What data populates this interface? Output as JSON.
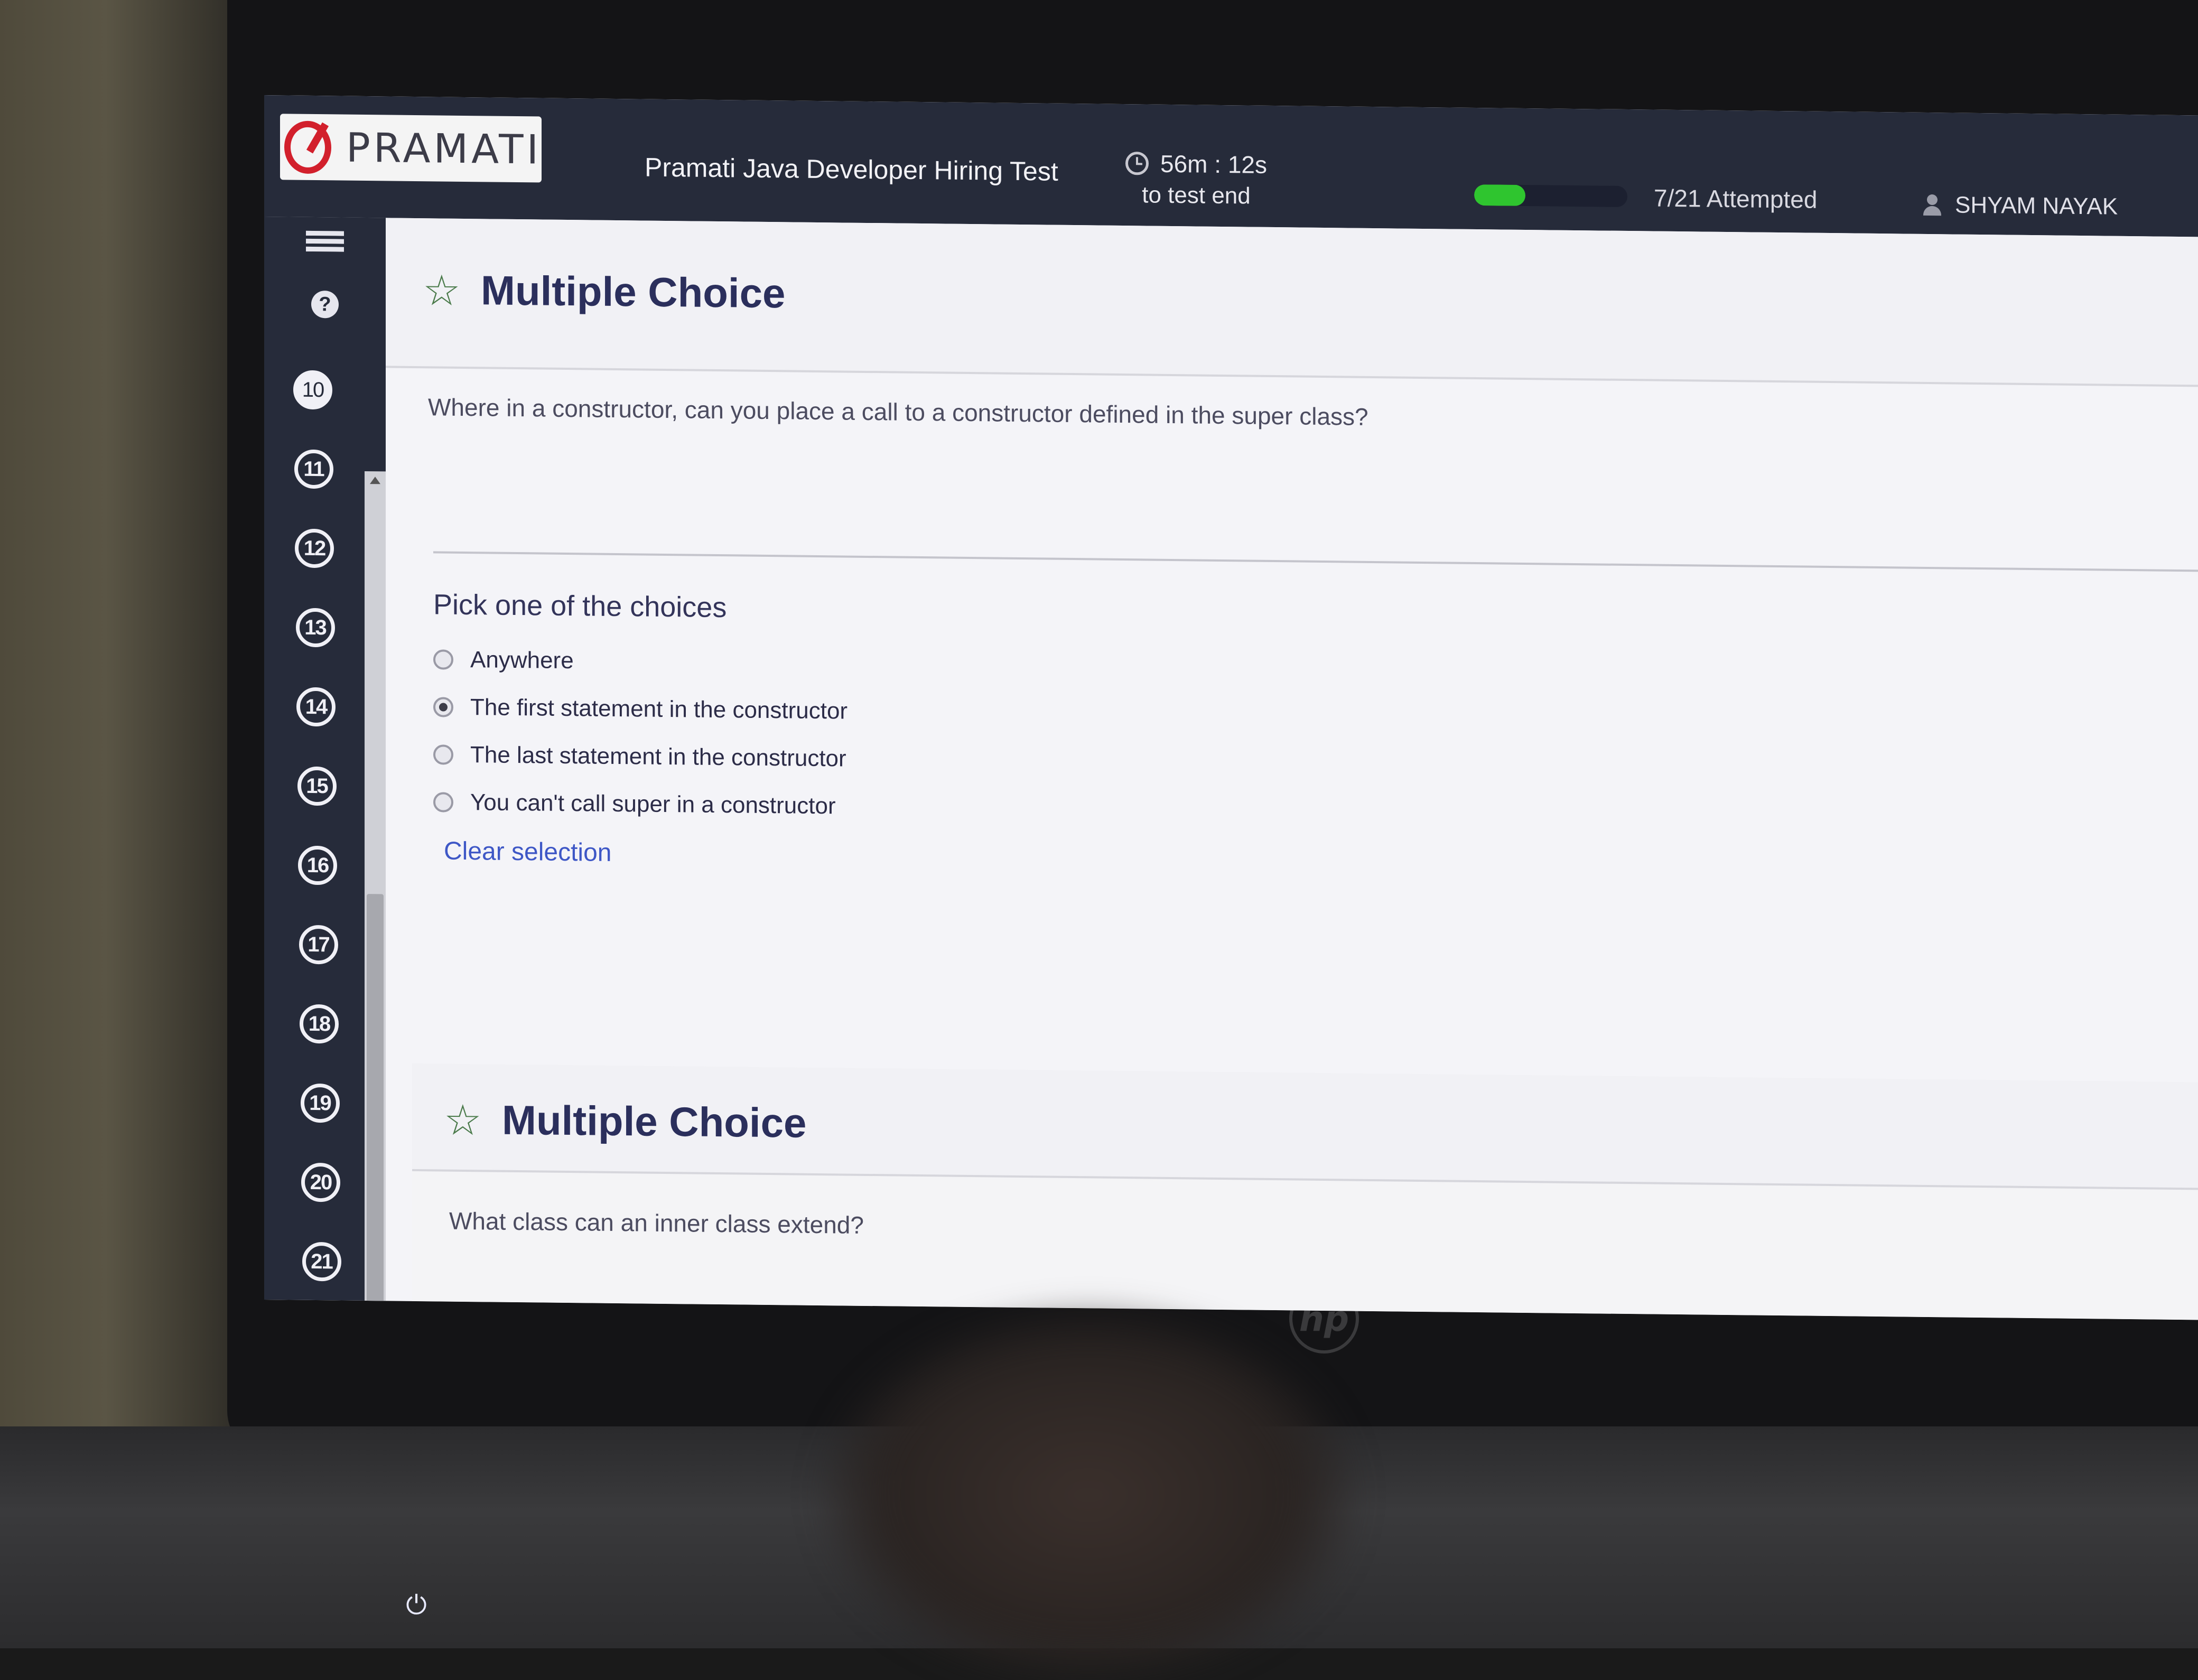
{
  "header": {
    "logo_text": "PRAMATI",
    "test_title": "Pramati Java Developer Hiring Test",
    "timer": "56m : 12s",
    "timer_sub": "to test end",
    "progress_fraction": 0.333,
    "attempted": "7/21 Attempted",
    "user_name": "SHYAM NAYAK",
    "accent_color": "#2fc52f"
  },
  "sidebar": {
    "icons": [
      "list-icon",
      "help-icon"
    ],
    "help_label": "?",
    "questions": [
      "10",
      "11",
      "12",
      "13",
      "14",
      "15",
      "16",
      "17",
      "18",
      "19",
      "20",
      "21"
    ],
    "current": "10"
  },
  "questions": [
    {
      "type_label": "Multiple Choice",
      "text": "Where in a constructor, can you place a call to a constructor defined in the super class?",
      "pick_label": "Pick one of the choices",
      "choices": [
        {
          "label": "Anywhere",
          "selected": false
        },
        {
          "label": "The first statement in the constructor",
          "selected": true
        },
        {
          "label": "The last statement in the constructor",
          "selected": false
        },
        {
          "label": "You can't call super in a constructor",
          "selected": false
        }
      ],
      "clear_label": "Clear selection"
    },
    {
      "type_label": "Multiple Choice",
      "text": "What class can an inner class extend?"
    }
  ]
}
